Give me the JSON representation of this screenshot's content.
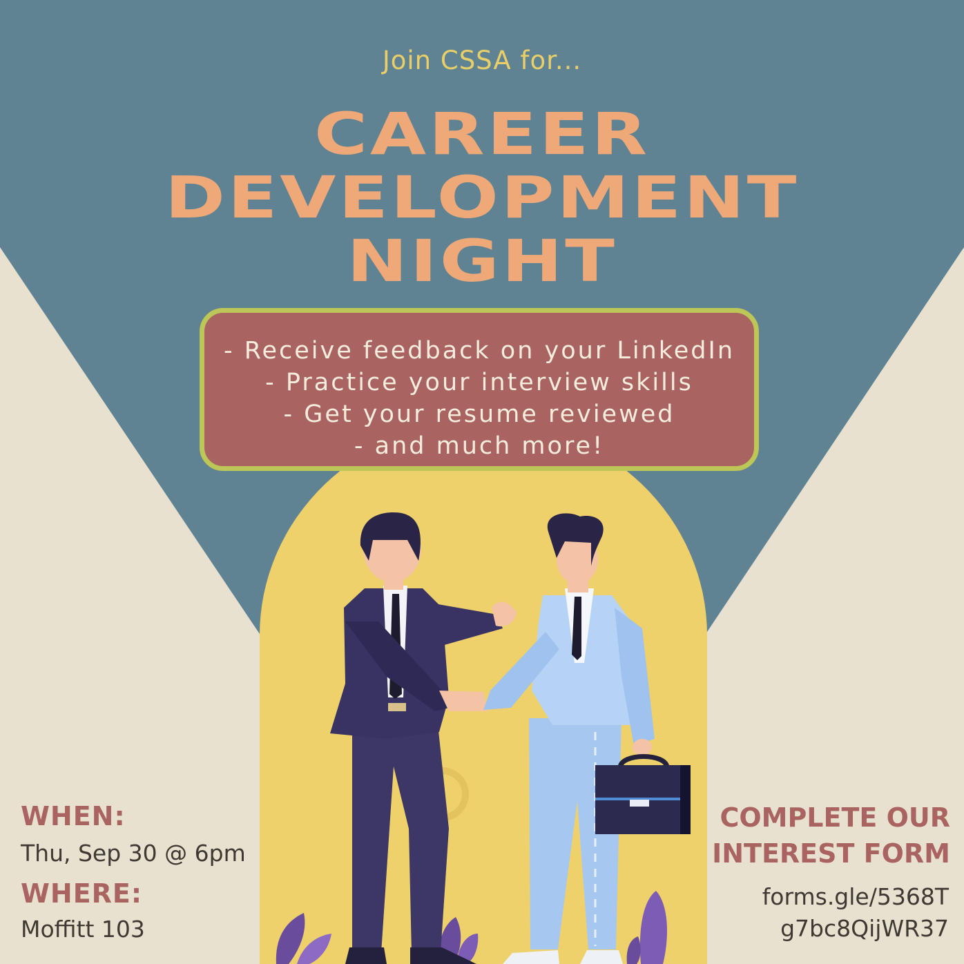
{
  "header": {
    "intro": "Join CSSA for...",
    "title_lines": [
      "CAREER",
      "DEVELOPMENT",
      "NIGHT"
    ]
  },
  "features": [
    "- Receive feedback on your LinkedIn",
    "- Practice your interview skills",
    "- Get your resume reviewed",
    "- and much more!"
  ],
  "event": {
    "when_label": "WHEN:",
    "when_value": "Thu, Sep 30 @ 6pm",
    "where_label": "WHERE:",
    "where_value": "Moffitt 103"
  },
  "form": {
    "cta_lines": [
      "COMPLETE OUR",
      "INTEREST FORM"
    ],
    "link_lines": [
      "forms.gle/5368T",
      "g7bc8QijWR37"
    ]
  },
  "colors": {
    "background": "#e9e1cf",
    "slate_blue": "#5f8393",
    "title_orange": "#efa878",
    "intro_yellow": "#e9cf6a",
    "box_red": "#a96461",
    "box_border_green": "#bcc758",
    "arch_yellow": "#efd16b"
  }
}
